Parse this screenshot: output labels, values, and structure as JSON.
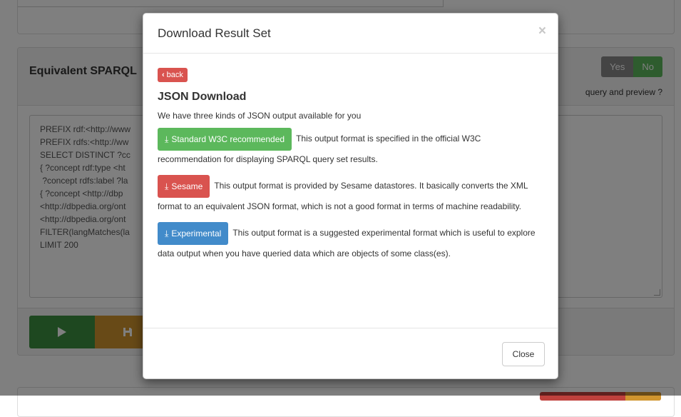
{
  "background": {
    "panel_title": "Equivalent SPARQL",
    "toggle": {
      "yes": "Yes",
      "no": "No"
    },
    "hint": "query and preview ?",
    "query_lines": "PREFIX rdf:<http://www\nPREFIX rdfs:<http://ww\nSELECT DISTINCT ?cc\n{ ?concept rdf:type <ht\n ?concept rdfs:label ?la\n{ ?concept <http://dbp\n<http://dbpedia.org/ont\n<http://dbpedia.org/ont\nFILTER(langMatches(la\nLIMIT 200",
    "run_icon": "play-icon",
    "save_icon": "save-icon"
  },
  "modal": {
    "title": "Download Result Set",
    "close_x": "×",
    "back_label": "back",
    "section_title": "JSON Download",
    "intro": "We have three kinds of JSON output available for you",
    "formats": [
      {
        "label": "Standard W3C recommended",
        "description": "This output format is specified in the official W3C recommendation for displaying SPARQL query set results.",
        "color": "#5cb85c"
      },
      {
        "label": "Sesame",
        "description": "This output format is provided by Sesame datastores. It basically converts the XML format to an equivalent JSON format, which is not a good format in terms of machine readability.",
        "color": "#d9534f"
      },
      {
        "label": "Experimental",
        "description": "This output format is a suggested experimental format which is useful to explore data output when you have queried data which are objects of some class(es).",
        "color": "#428bca"
      }
    ],
    "close_button": "Close"
  }
}
